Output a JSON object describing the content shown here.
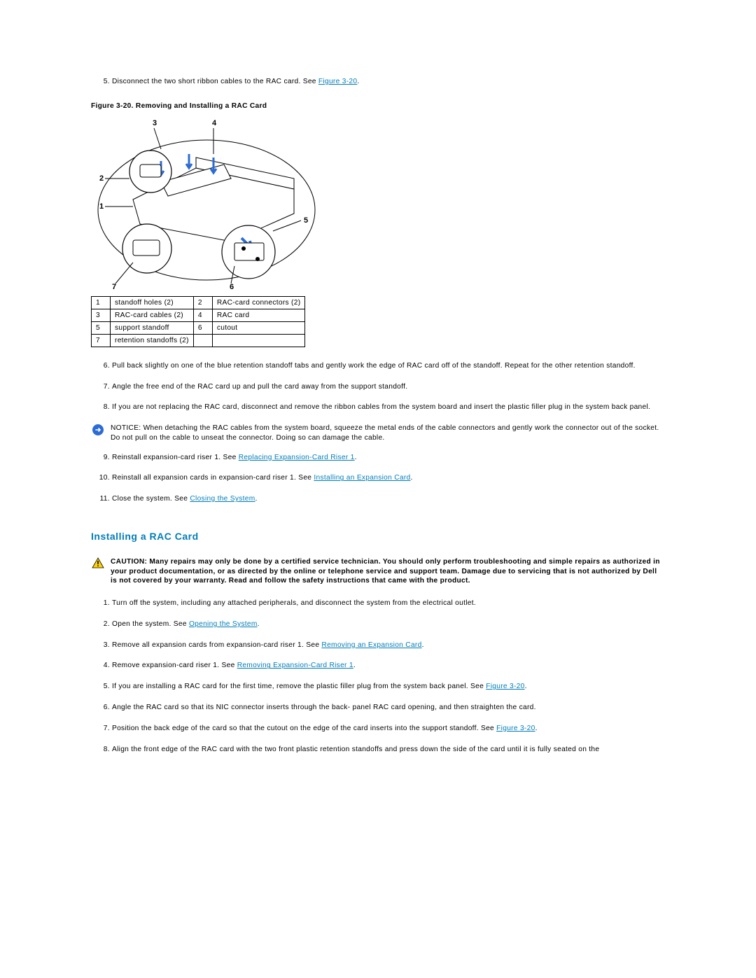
{
  "step5": {
    "num": "5.",
    "text": "Disconnect the two short ribbon cables to the RAC card. See ",
    "link": "Figure 3-20",
    "after": "."
  },
  "figure_caption": "Figure 3-20. Removing and Installing a RAC Card",
  "key_table": [
    [
      "1",
      "standoff holes (2)",
      "2",
      "RAC-card connectors (2)"
    ],
    [
      "3",
      "RAC-card cables (2)",
      "4",
      "RAC card"
    ],
    [
      "5",
      "support standoff",
      "6",
      "cutout"
    ],
    [
      "7",
      "retention standoffs (2)",
      "",
      ""
    ]
  ],
  "steps_a": {
    "s6": "Pull back slightly on one of the blue retention standoff tabs and gently work the edge of RAC card off of the standoff. Repeat for the other retention standoff.",
    "s7": "Angle the free end of the RAC card up and pull the card away from the support standoff.",
    "s8": "If you are not replacing the RAC card, disconnect and remove the ribbon cables from the system board and insert the plastic filler plug in the system back panel."
  },
  "notice": {
    "label": "NOTICE:",
    "text": "When detaching the RAC cables from the system board, squeeze the metal ends of the cable connectors and gently work the connector out of the socket. Do not pull on the cable to unseat the connector. Doing so can damage the cable."
  },
  "steps_b": {
    "s9_pre": "Reinstall expansion-card riser 1. See ",
    "s9_link": "Replacing Expansion-Card Riser 1",
    "s9_post": ".",
    "s10_pre": "Reinstall all expansion cards in expansion-card riser 1. See ",
    "s10_link": "Installing an Expansion Card",
    "s10_post": ".",
    "s11_pre": "Close the system. See ",
    "s11_link": "Closing the System",
    "s11_post": "."
  },
  "section_heading": "Installing a RAC Card",
  "caution": {
    "label": "CAUTION:",
    "text": "Many repairs may only be done by a certified service technician. You should only perform troubleshooting and simple repairs as authorized in your product documentation, or as directed by the online or telephone service and support team. Damage due to servicing that is not authorized by Dell is not covered by your warranty. Read and follow the safety instructions that came with the product."
  },
  "install_steps": {
    "s1": "Turn off the system, including any attached peripherals, and disconnect the system from the electrical outlet.",
    "s2_pre": "Open the system. See ",
    "s2_link": "Opening the System",
    "s2_post": ".",
    "s3_pre": "Remove all expansion cards from expansion-card riser 1. See ",
    "s3_link": "Removing an Expansion Card",
    "s3_post": ".",
    "s4_pre": "Remove expansion-card riser 1. See ",
    "s4_link": "Removing Expansion-Card Riser 1",
    "s4_post": ".",
    "s5_pre": "If you are installing a RAC card for the first time, remove the plastic filler plug from the system back panel. See ",
    "s5_link": "Figure 3-20",
    "s5_post": ".",
    "s6": "Angle the RAC card so that its NIC connector inserts through the back- panel RAC card opening, and then straighten the card.",
    "s7_pre": "Position the back edge of the card so that the cutout on the edge of the card inserts into the support standoff. See ",
    "s7_link": "Figure 3-20",
    "s7_post": ".",
    "s8": "Align the front edge of the RAC card with the two front plastic retention standoffs and press down the side of the card until it is fully seated on the"
  },
  "diagram_labels": {
    "l1": "1",
    "l2": "2",
    "l3": "3",
    "l4": "4",
    "l5": "5",
    "l6": "6",
    "l7": "7"
  }
}
